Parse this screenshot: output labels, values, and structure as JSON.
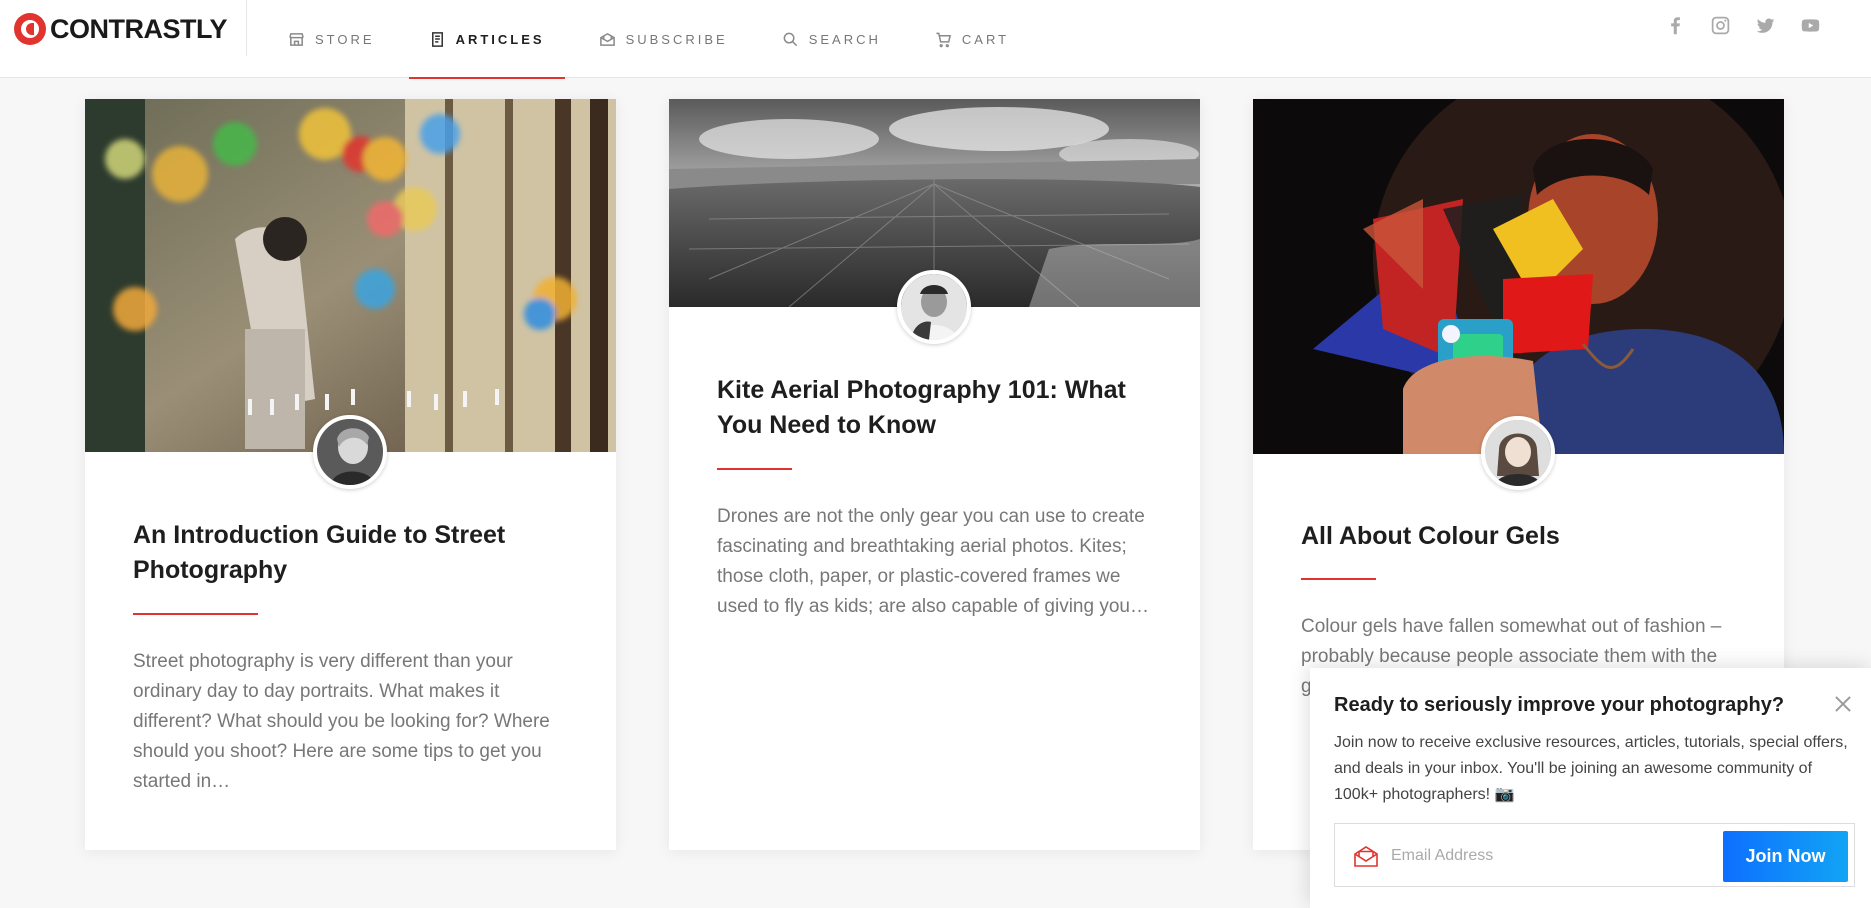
{
  "brand": {
    "name": "CONTRASTLY"
  },
  "nav": [
    {
      "label": "STORE",
      "icon": "store-icon"
    },
    {
      "label": "ARTICLES",
      "icon": "articles-icon",
      "active": true
    },
    {
      "label": "SUBSCRIBE",
      "icon": "subscribe-icon"
    },
    {
      "label": "SEARCH",
      "icon": "search-icon"
    },
    {
      "label": "CART",
      "icon": "cart-icon"
    }
  ],
  "social": [
    "facebook-icon",
    "instagram-icon",
    "twitter-icon",
    "youtube-icon"
  ],
  "articles": [
    {
      "title": "An Introduction Guide to Street Photography",
      "excerpt": "Street photography is very different than your ordinary day to day portraits. What makes it different? What should you be looking for? Where should you shoot? Here are some tips to get you started in…"
    },
    {
      "title": "Kite Aerial Photography 101: What You Need to Know",
      "excerpt": "Drones are not the only gear you can use to create fascinating and breathtaking aerial photos. Kites; those cloth, paper, or plastic-covered frames we used to fly as kids; are also capable of giving you…"
    },
    {
      "title": "All About Colour Gels",
      "excerpt": "Colour gels have fallen somewhat out of fashion – probably because people associate them with the g… B…"
    }
  ],
  "popup": {
    "title": "Ready to seriously improve your photography?",
    "body": "Join now to receive exclusive resources, articles, tutorials, special offers, and deals in your inbox. You'll be joining an awesome community of 100k+ photographers! 📷",
    "email_placeholder": "Email Address",
    "button_label": "Join Now"
  },
  "colors": {
    "accent": "#e2342e",
    "button": "#0d6fff"
  }
}
